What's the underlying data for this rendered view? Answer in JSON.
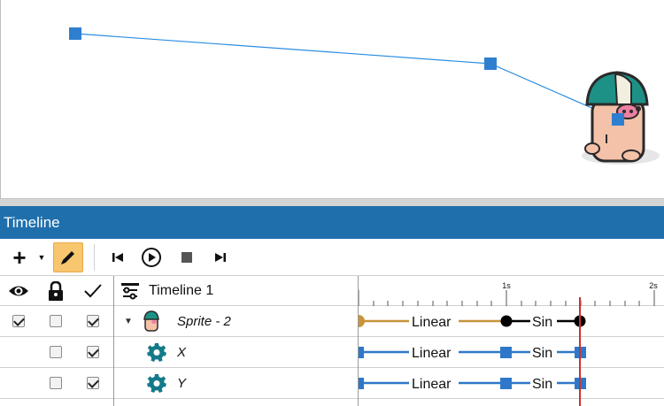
{
  "panel": {
    "title": "Timeline"
  },
  "timeline": {
    "name": "Timeline 1",
    "ruler_marks": [
      "1s",
      "2s"
    ]
  },
  "tracks": [
    {
      "name": "Sprite - 2",
      "visible": true,
      "locked": false,
      "enabled": true,
      "expanded": true,
      "segments": [
        "Linear",
        "Sin"
      ],
      "keyframe_color": "#000000",
      "line_color": "#c8943a"
    },
    {
      "name": "X",
      "locked": false,
      "enabled": true,
      "segments": [
        "Linear",
        "Sin"
      ],
      "keyframe_color": "#2f78c9",
      "line_color": "#2f78c9"
    },
    {
      "name": "Y",
      "locked": false,
      "enabled": true,
      "segments": [
        "Linear",
        "Sin"
      ],
      "keyframe_color": "#2f78c9",
      "line_color": "#2f78c9"
    }
  ],
  "icons": {
    "add": "plus-icon",
    "add_menu": "caret-down-icon",
    "edit": "pencil-icon",
    "first": "skip-to-start-icon",
    "play": "play-icon",
    "stop": "stop-icon",
    "last": "skip-to-end-icon",
    "visibility": "eye-icon",
    "lock": "lock-icon",
    "enabled": "check-icon",
    "timeline": "timeline-icon",
    "property": "gear-icon",
    "sprite": "pig-sprite-icon"
  },
  "colors": {
    "header_bg": "#1f6fad",
    "active_tool_bg": "#f7c66f",
    "path_color": "#2b8de0",
    "playhead": "#d0302a",
    "gear": "#147a8a"
  }
}
